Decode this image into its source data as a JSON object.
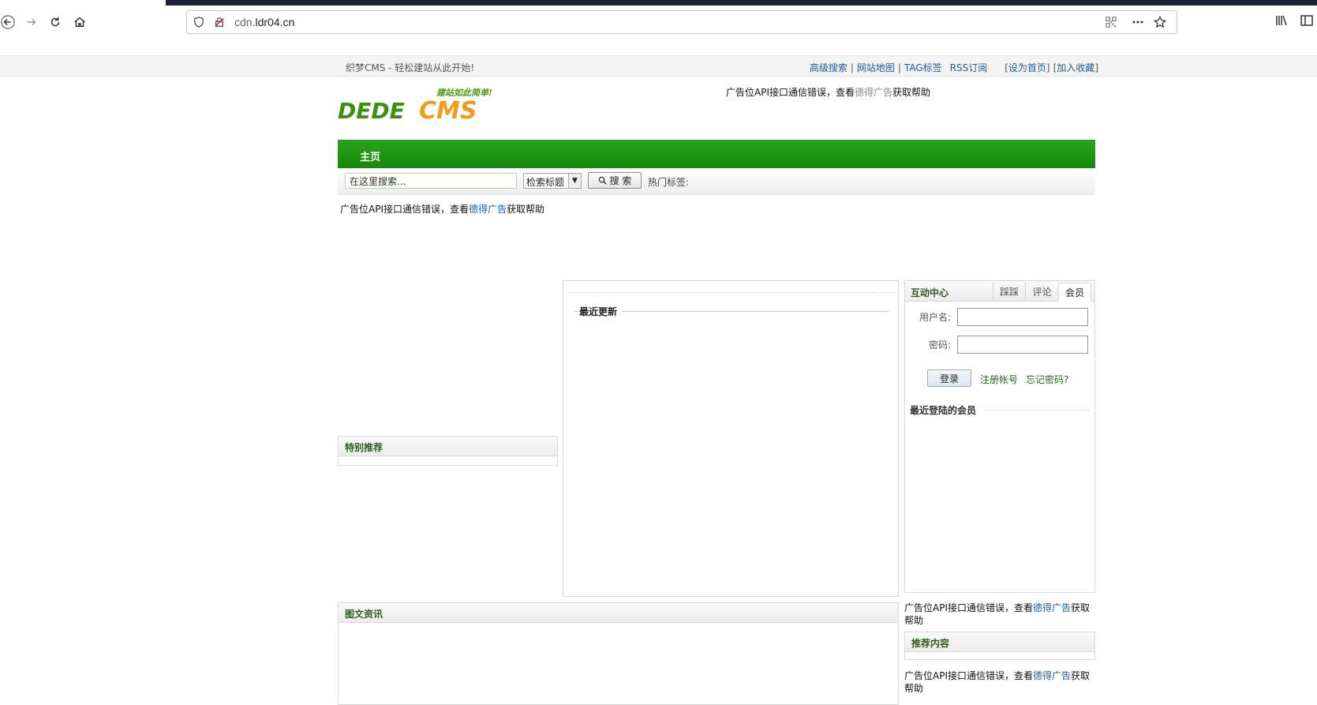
{
  "browser": {
    "url_dim": "cdn.",
    "url_main": "ldr04.cn"
  },
  "sitebar": {
    "welcome": "织梦CMS - 轻松建站从此开始!",
    "links": [
      "高级搜索",
      "网站地图",
      "TAG标签",
      "RSS订阅"
    ],
    "set_home": "设为首页",
    "add_fav": "加入收藏"
  },
  "logo": {
    "text_left": "DEDE",
    "text_right": "CMS",
    "slogan": "建站如此简单!"
  },
  "ad": {
    "prefix": "广告位API接口通信错误，查看",
    "link": "德得广告",
    "suffix": "获取帮助"
  },
  "nav": {
    "home": "主页"
  },
  "search": {
    "placeholder": "在这里搜索...",
    "select_value": "检索标题",
    "button": "搜 索",
    "hot_tags": "热门标签:"
  },
  "sections": {
    "special": "特别推荐",
    "recent": "最近更新",
    "picnews": "图文资讯",
    "recommended": "推荐内容"
  },
  "member": {
    "title": "互动中心",
    "tabs": [
      "踩踩",
      "评论",
      "会员"
    ],
    "username_label": "用户名:",
    "password_label": "密码:",
    "login": "登录",
    "register": "注册帐号",
    "forgot": "忘记密码?",
    "recent_members": "最近登陆的会员"
  }
}
